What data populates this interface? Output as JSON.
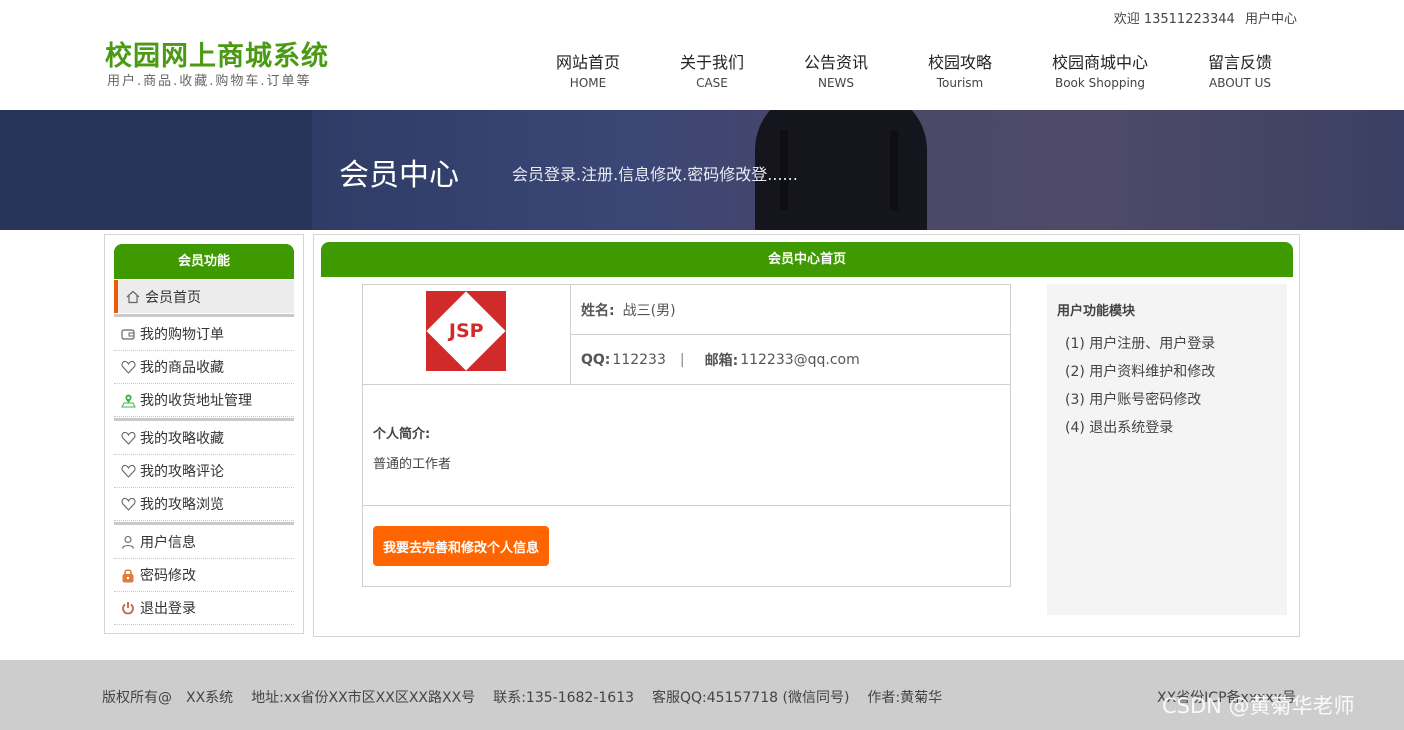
{
  "header": {
    "welcome": "欢迎 13511223344",
    "user_center": "用户中心",
    "logo_title": "校园网上商城系统",
    "logo_sub": "用户.商品.收藏.购物车.订单等",
    "nav": [
      {
        "cn": "网站首页",
        "en": "HOME"
      },
      {
        "cn": "关于我们",
        "en": "CASE"
      },
      {
        "cn": "公告资讯",
        "en": "NEWS"
      },
      {
        "cn": "校园攻略",
        "en": "Tourism"
      },
      {
        "cn": "校园商城中心",
        "en": "Book Shopping"
      },
      {
        "cn": "留言反馈",
        "en": "ABOUT US"
      }
    ]
  },
  "banner": {
    "title": "会员中心",
    "desc": "会员登录.注册.信息修改.密码修改登......"
  },
  "sidebar": {
    "title": "会员功能",
    "items": [
      {
        "label": "会员首页",
        "icon": "home-icon"
      },
      {
        "label": "我的购物订单",
        "icon": "wallet-icon"
      },
      {
        "label": "我的商品收藏",
        "icon": "heart-icon"
      },
      {
        "label": "我的收货地址管理",
        "icon": "location-icon"
      },
      {
        "label": "我的攻略收藏",
        "icon": "heart-icon"
      },
      {
        "label": "我的攻略评论",
        "icon": "heart-icon"
      },
      {
        "label": "我的攻略浏览",
        "icon": "heart-icon"
      },
      {
        "label": "用户信息",
        "icon": "user-icon"
      },
      {
        "label": "密码修改",
        "icon": "lock-icon"
      },
      {
        "label": "退出登录",
        "icon": "power-icon"
      }
    ]
  },
  "main": {
    "title": "会员中心首页",
    "avatar_text": "JSP",
    "name_label": "姓名:",
    "name_value": "战三(男)",
    "qq_label": "QQ:",
    "qq_value": "112233",
    "separator": "|",
    "email_label": "邮箱:",
    "email_value": "112233@qq.com",
    "intro_label": "个人简介:",
    "intro_text": "普通的工作者",
    "edit_button": "我要去完善和修改个人信息"
  },
  "functions": {
    "title": "用户功能模块",
    "items": [
      "(1) 用户注册、用户登录",
      "(2) 用户资料维护和修改",
      "(3) 用户账号密码修改",
      "(4) 退出系统登录"
    ]
  },
  "footer": {
    "copyright": "版权所有@",
    "system": "XX系统",
    "address": "地址:xx省份XX市区XX区XX路XX号",
    "contact": "联系:135-1682-1613",
    "qq": "客服QQ:45157718 (微信同号)",
    "author": "作者:黄菊华",
    "icp": "XX省份ICP备xxxxx号",
    "watermark": "CSDN @黄菊华老师"
  },
  "colors": {
    "brand_green": "#3e9a00",
    "logo_green": "#4a9a14",
    "accent_orange": "#fe6500",
    "active_marker": "#ee5a06"
  }
}
